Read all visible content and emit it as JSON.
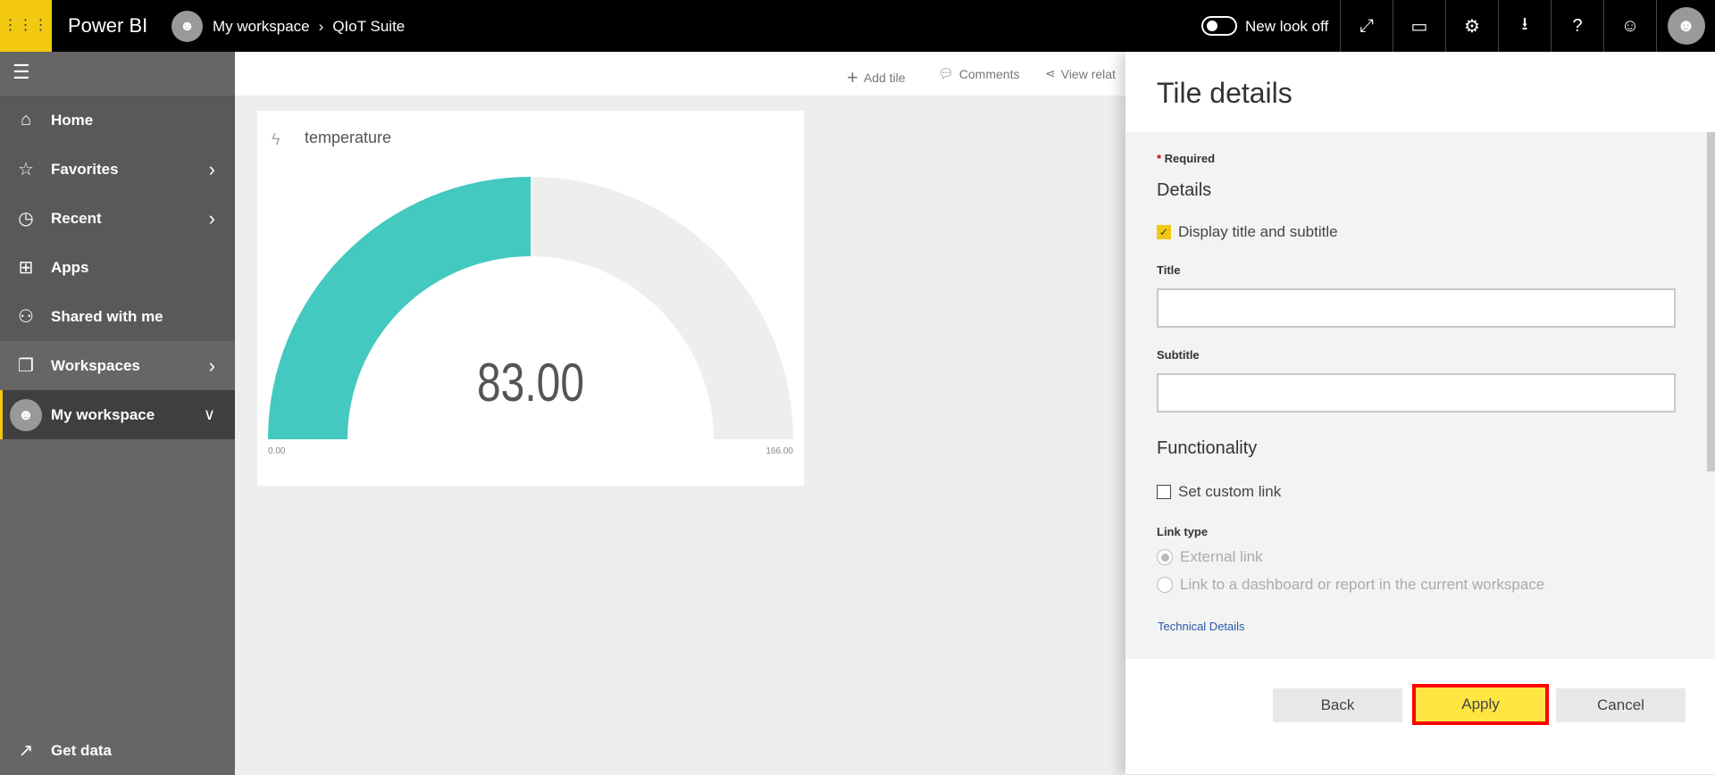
{
  "header": {
    "app_name": "Power BI",
    "breadcrumb": [
      "My workspace",
      "QIoT Suite"
    ],
    "new_look_label": "New look off",
    "new_look_on": false,
    "icons": [
      "expand-icon",
      "comment-icon",
      "gear-icon",
      "download-icon",
      "help-icon",
      "smiley-icon"
    ]
  },
  "sidebar": {
    "items": [
      {
        "label": "Home",
        "icon": "home-icon"
      },
      {
        "label": "Favorites",
        "icon": "star-icon"
      },
      {
        "label": "Recent",
        "icon": "clock-icon"
      },
      {
        "label": "Apps",
        "icon": "apps-icon"
      },
      {
        "label": "Shared with me",
        "icon": "shared-icon"
      },
      {
        "label": "Workspaces",
        "icon": "workspaces-icon"
      },
      {
        "label": "My workspace",
        "icon": "avatar"
      }
    ],
    "get_data": "Get data"
  },
  "toolbar": {
    "add_tile": "Add tile",
    "comments": "Comments",
    "view_related": "View relat"
  },
  "tile": {
    "title": "temperature",
    "value": "83.00",
    "min": "0.00",
    "max": "166.00",
    "gauge_value": 83,
    "gauge_min": 0,
    "gauge_max": 166,
    "fill_color": "#43c9bf",
    "track_color": "#eeeeee"
  },
  "panel": {
    "title": "Tile details",
    "required": "Required",
    "details": "Details",
    "display_title_label": "Display title and subtitle",
    "display_title_checked": true,
    "title_label": "Title",
    "title_value": "",
    "subtitle_label": "Subtitle",
    "subtitle_value": "",
    "functionality": "Functionality",
    "custom_link_label": "Set custom link",
    "custom_link_checked": false,
    "link_type": "Link type",
    "external_link": "External link",
    "internal_link": "Link to a dashboard or report in the current workspace",
    "technical_details": "Technical Details",
    "back": "Back",
    "apply": "Apply",
    "cancel": "Cancel",
    "accent": "#f2c811",
    "apply_color": "#ffe643",
    "highlight": "#ff0000"
  }
}
